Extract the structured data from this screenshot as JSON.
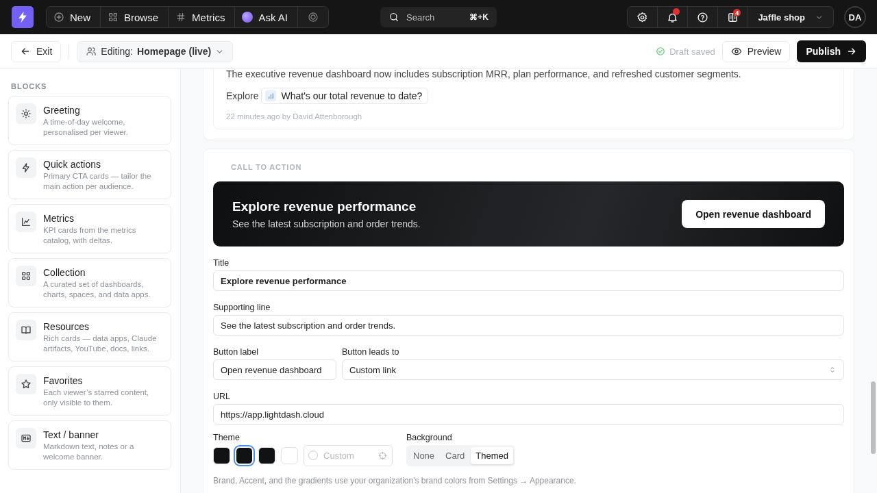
{
  "app_bar": {
    "nav": [
      {
        "label": "New"
      },
      {
        "label": "Browse"
      },
      {
        "label": "Metrics"
      },
      {
        "label": "Ask AI"
      }
    ],
    "search": {
      "placeholder": "Search",
      "shortcut": "⌘+K"
    },
    "notifications": {
      "unread": true
    },
    "reports": {
      "badge": "4"
    },
    "workspace": "Jaffle shop",
    "avatar": "DA"
  },
  "toolbar": {
    "exit": "Exit",
    "editing_label": "Editing:",
    "page": "Homepage (live)",
    "status": "Draft saved",
    "preview": "Preview",
    "publish": "Publish"
  },
  "sidebar": {
    "heading": "BLOCKS",
    "blocks": [
      {
        "title": "Greeting",
        "description": "A time-of-day welcome, personalised per viewer."
      },
      {
        "title": "Quick actions",
        "description": "Primary CTA cards — tailor the main action per audience."
      },
      {
        "title": "Metrics",
        "description": "KPI cards from the metrics catalog, with deltas."
      },
      {
        "title": "Collection",
        "description": "A curated set of dashboards, charts, spaces, and data apps."
      },
      {
        "title": "Resources",
        "description": "Rich cards — data apps, Claude artifacts, YouTube, docs, links."
      },
      {
        "title": "Favorites",
        "description": "Each viewer’s starred content, only visible to them."
      },
      {
        "title": "Text / banner",
        "description": "Markdown text, notes or a welcome banner."
      }
    ]
  },
  "update_card": {
    "body": "The executive revenue dashboard now includes subscription MRR, plan performance, and refreshed customer segments.",
    "explore_label": "Explore",
    "question": "What's our total revenue to date?",
    "meta": "22 minutes ago by David Attenborough"
  },
  "cta_section": {
    "heading": "CALL TO ACTION",
    "preview": {
      "title": "Explore revenue performance",
      "subtitle": "See the latest subscription and order trends.",
      "button": "Open revenue dashboard"
    },
    "title_field": {
      "label": "Title",
      "value": "Explore revenue performance"
    },
    "supporting_field": {
      "label": "Supporting line",
      "value": "See the latest subscription and order trends."
    },
    "button_label_field": {
      "label": "Button label",
      "value": "Open revenue dashboard"
    },
    "button_target_field": {
      "label": "Button leads to",
      "value": "Custom link"
    },
    "url_field": {
      "label": "URL",
      "value": "https://app.lightdash.cloud"
    },
    "theme": {
      "label": "Theme",
      "swatches": [
        {
          "color": "#111214",
          "selected": false
        },
        {
          "color": "#111214",
          "selected": true
        },
        {
          "color": "#111214",
          "selected": false
        },
        {
          "color": "#ffffff",
          "selected": false
        }
      ],
      "custom_placeholder": "Custom"
    },
    "background": {
      "label": "Background",
      "options": [
        {
          "label": "None",
          "selected": false
        },
        {
          "label": "Card",
          "selected": false
        },
        {
          "label": "Themed",
          "selected": true
        }
      ]
    },
    "hint": "Brand, Accent, and the gradients use your organization's brand colors from Settings → Appearance."
  }
}
